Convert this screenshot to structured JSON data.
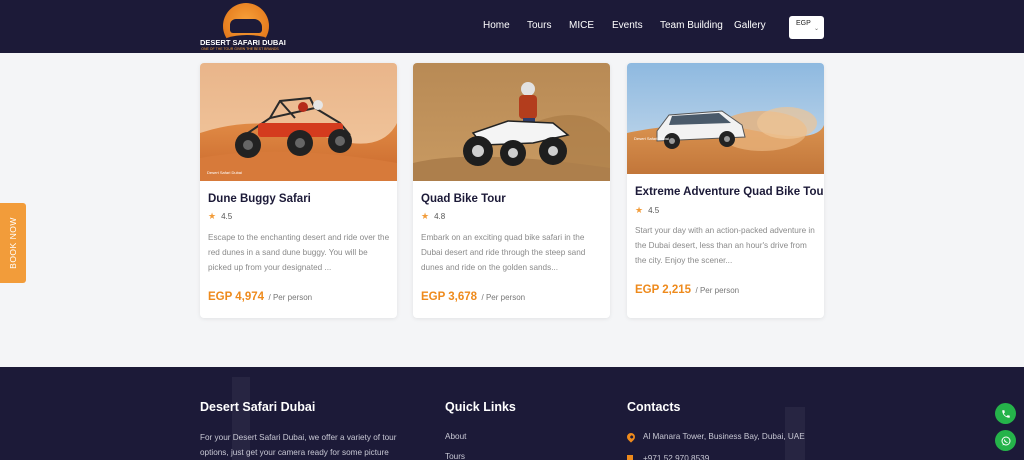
{
  "header": {
    "logo_text": "DESERT SAFARI DUBAI",
    "logo_tagline": "ONE OF THE TOUR GIVEN THE BEST BRANDS",
    "nav": [
      {
        "label": "Home"
      },
      {
        "label": "Tours"
      },
      {
        "label": "MICE"
      },
      {
        "label": "Events"
      },
      {
        "label": "Team Building"
      },
      {
        "label": "Gallery"
      }
    ],
    "currency": "EGP",
    "currency_caret": "⌄"
  },
  "cards": [
    {
      "title": "Dune Buggy Safari",
      "rating": "4.5",
      "description": "Escape to the enchanting desert and ride over the red dunes in a sand dune buggy. You will be picked up from your designated ...",
      "price": "EGP 4,974",
      "price_unit": "/ Per person",
      "image_caption": "Desert Safari Dubai"
    },
    {
      "title": "Quad Bike Tour",
      "rating": "4.8",
      "description": "Embark on an exciting quad bike safari in the Dubai desert and ride through the steep sand dunes and ride on the golden sands...",
      "price": "EGP 3,678",
      "price_unit": "/ Per person"
    },
    {
      "title": "Extreme Adventure Quad Bike Tour",
      "rating": "4.5",
      "description": "Start your day with an action-packed adventure in the Dubai desert, less than an hour's drive from the city. Enjoy the scener...",
      "price": "EGP 2,215",
      "price_unit": "/ Per person",
      "image_caption": "Desert Safari Dubai"
    }
  ],
  "book_now": "BOOK NOW",
  "footer": {
    "about_title": "Desert Safari Dubai",
    "about_text": "For your Desert Safari Dubai, we offer a variety of tour options, just get your camera ready for some picture",
    "links_title": "Quick Links",
    "links": [
      "About",
      "Tours"
    ],
    "contacts_title": "Contacts",
    "address": "Al Manara Tower, Business Bay, Dubai, UAE",
    "phone": "+971 52 970 8539"
  },
  "colors": {
    "navy": "#1c1a38",
    "accent": "#ee8a1c",
    "whatsapp": "#25b34a"
  },
  "icons": [
    "star-icon",
    "location-pin-icon",
    "phone-icon",
    "whatsapp-icon",
    "chevron-down-icon"
  ]
}
